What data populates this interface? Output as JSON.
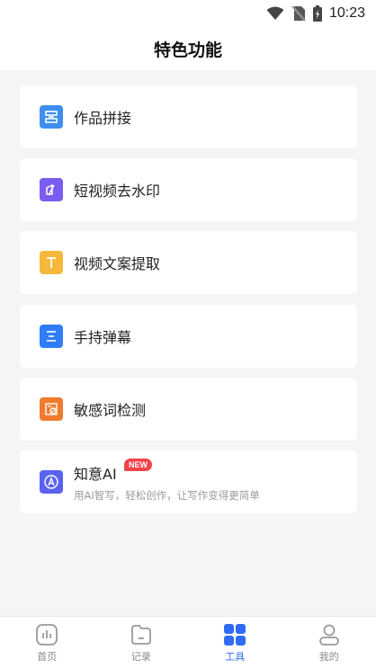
{
  "status_bar": {
    "time": "10:23",
    "icons": [
      "wifi-icon",
      "no-sim-icon",
      "battery-icon"
    ]
  },
  "header": {
    "title": "特色功能"
  },
  "features": [
    {
      "label": "作品拼接",
      "icon": "splice-icon",
      "color": "#3e8ef0"
    },
    {
      "label": "短视频去水印",
      "icon": "watermark-remove-icon",
      "color": "#7a5cf0"
    },
    {
      "label": "视频文案提取",
      "icon": "text-extract-icon",
      "color": "#f5b83a"
    },
    {
      "label": "手持弹幕",
      "icon": "handheld-barrage-icon",
      "color": "#2f7cf6"
    },
    {
      "label": "敏感词检测",
      "icon": "sensitive-word-icon",
      "color": "#f07a2e"
    }
  ],
  "ai_card": {
    "title": "知意AI",
    "badge": "NEW",
    "subtitle": "用AI智写，轻松创作，让写作变得更简单",
    "icon": "ai-icon",
    "color": "#5a63f0"
  },
  "tabs": [
    {
      "label": "首页",
      "icon": "chart-icon",
      "active": false
    },
    {
      "label": "记录",
      "icon": "folder-icon",
      "active": false
    },
    {
      "label": "工具",
      "icon": "grid-icon",
      "active": true
    },
    {
      "label": "我的",
      "icon": "user-icon",
      "active": false
    }
  ],
  "colors": {
    "accent": "#2f6bf5",
    "background": "#f4f5f7",
    "badge": "#f2434a"
  }
}
